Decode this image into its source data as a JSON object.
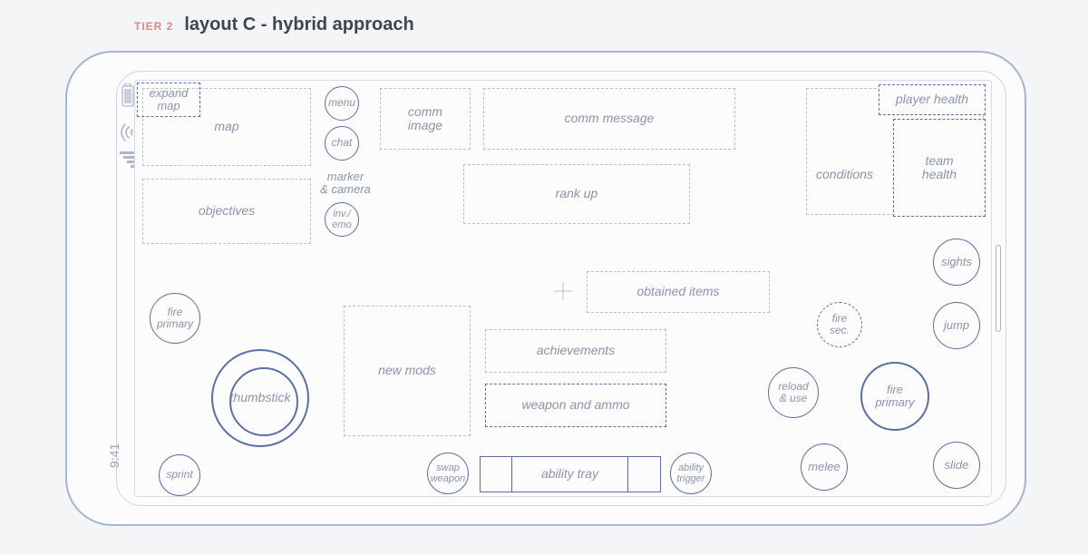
{
  "header": {
    "tier": "TIER 2",
    "title": "layout C - hybrid approach"
  },
  "status": {
    "clock": "9:41"
  },
  "zones": {
    "map": "map",
    "expand_map": "expand\nmap",
    "objectives": "objectives",
    "menu": "menu",
    "chat": "chat",
    "marker_camera": "marker\n& camera",
    "inv_emo": "inv./\nemo",
    "comm_image": "comm\nimage",
    "comm_message": "comm message",
    "rank_up": "rank up",
    "conditions": "conditions",
    "player_health": "player health",
    "team_health": "team\nhealth",
    "obtained_items": "obtained items",
    "new_mods": "new mods",
    "achievements": "achievements",
    "weapon_ammo": "weapon and ammo",
    "swap_weapon": "swap\nweapon",
    "ability_tray": "ability tray",
    "ability_trigger": "ability\ntrigger",
    "fire_primary_left": "fire\nprimary",
    "thumbstick": "thumbstick",
    "sprint": "sprint",
    "fire_secondary": "fire\nsec.",
    "reload_use": "reload\n& use",
    "melee": "melee",
    "sights": "sights",
    "jump": "jump",
    "fire_primary_right": "fire\nprimary",
    "slide": "slide"
  }
}
